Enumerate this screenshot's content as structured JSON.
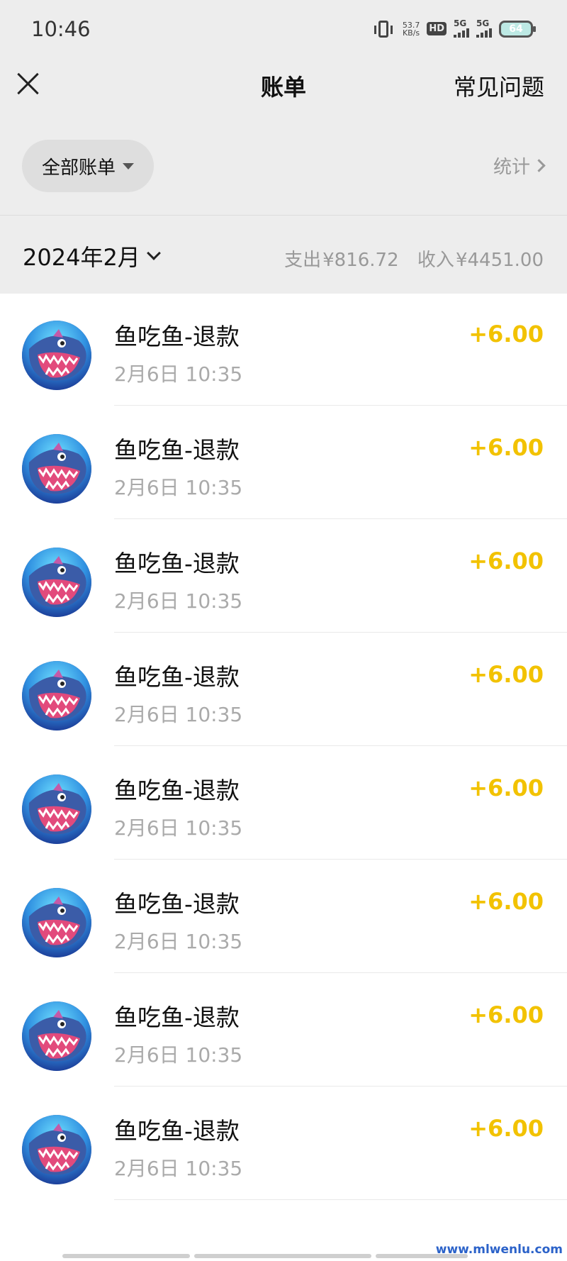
{
  "status_bar": {
    "time": "10:46",
    "net_speed_value": "53.7",
    "net_speed_unit": "KB/s",
    "hd_label": "HD",
    "sim1_label": "5G",
    "sim2_label": "5G",
    "battery": "64"
  },
  "header": {
    "title": "账单",
    "faq_label": "常见问题",
    "close_icon": "close-icon"
  },
  "filter": {
    "selected": "全部账单",
    "stats_label": "统计"
  },
  "month_bar": {
    "month": "2024年2月",
    "expense_label": "支出",
    "expense_amount": "¥816.72",
    "income_label": "收入",
    "income_amount": "¥4451.00"
  },
  "transactions": [
    {
      "name": "鱼吃鱼-退款",
      "date": "2月6日 10:35",
      "amount": ""
    },
    {
      "name": "鱼吃鱼-退款",
      "date": "2月6日 10:35",
      "amount": "+6.00"
    },
    {
      "name": "鱼吃鱼-退款",
      "date": "2月6日 10:35",
      "amount": "+6.00"
    },
    {
      "name": "鱼吃鱼-退款",
      "date": "2月6日 10:35",
      "amount": "+6.00"
    },
    {
      "name": "鱼吃鱼-退款",
      "date": "2月6日 10:35",
      "amount": "+6.00"
    },
    {
      "name": "鱼吃鱼-退款",
      "date": "2月6日 10:35",
      "amount": "+6.00"
    },
    {
      "name": "鱼吃鱼-退款",
      "date": "2月6日 10:35",
      "amount": "+6.00"
    },
    {
      "name": "鱼吃鱼-退款",
      "date": "2月6日 10:35",
      "amount": "+6.00"
    },
    {
      "name": "鱼吃鱼-退款",
      "date": "2月6日 10:35",
      "amount": "+6.00"
    }
  ],
  "watermark": "www.mlwenlu.com",
  "colors": {
    "header_bg": "#ededed",
    "income_amount": "#f2c200",
    "muted_text": "#999999"
  }
}
